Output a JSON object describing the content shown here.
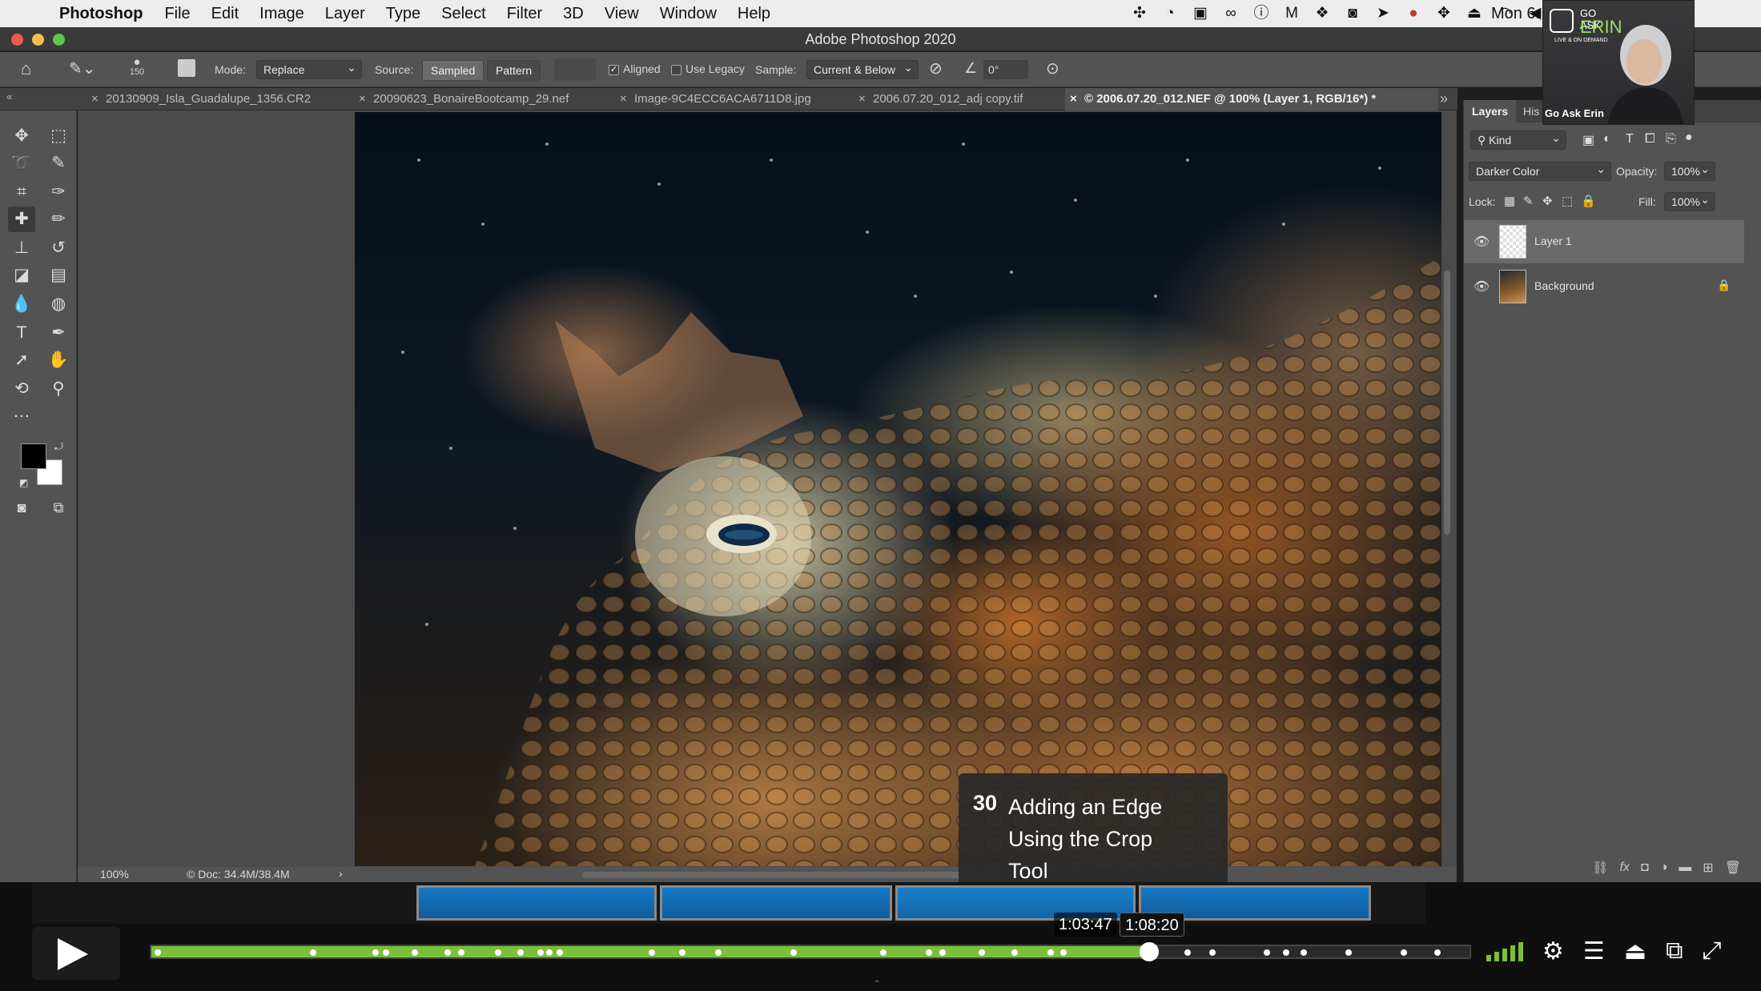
{
  "menubar": {
    "app_name": "Photoshop",
    "items": [
      "File",
      "Edit",
      "Image",
      "Layer",
      "Type",
      "Select",
      "Filter",
      "3D",
      "View",
      "Window",
      "Help"
    ],
    "clock": "Mon 6:"
  },
  "window": {
    "title": "Adobe Photoshop 2020"
  },
  "options": {
    "brush_size": "150",
    "mode_label": "Mode:",
    "mode_value": "Replace",
    "source_label": "Source:",
    "source_sampled": "Sampled",
    "source_pattern": "Pattern",
    "aligned_label": "Aligned",
    "aligned_checked": true,
    "use_legacy_label": "Use Legacy",
    "sample_label": "Sample:",
    "sample_value": "Current & Below",
    "angle_value": "0°"
  },
  "tabs": [
    {
      "label": "20130909_Isla_Guadalupe_1356.CR2",
      "active": false
    },
    {
      "label": "20090623_BonaireBootcamp_29.nef",
      "active": false
    },
    {
      "label": "Image-9C4ECC6ACA6711D8.jpg",
      "active": false
    },
    {
      "label": "2006.07.20_012_adj copy.tif",
      "active": false
    },
    {
      "label": "© 2006.07.20_012.NEF @ 100% (Layer 1, RGB/16*) *",
      "active": true
    }
  ],
  "status": {
    "zoom": "100%",
    "doc": "Doc: 34.4M/38.4M"
  },
  "layers_panel": {
    "tabs": [
      "Layers",
      "His"
    ],
    "kind_label": "Kind",
    "blend_mode": "Darker Color",
    "opacity_label": "Opacity:",
    "opacity_value": "100%",
    "lock_label": "Lock:",
    "fill_label": "Fill:",
    "fill_value": "100%",
    "layers": [
      {
        "name": "Layer 1",
        "selected": true,
        "locked": false
      },
      {
        "name": "Background",
        "selected": false,
        "locked": true
      }
    ]
  },
  "webcam": {
    "logo_top": "GO ASK",
    "logo_main": "ERIN",
    "logo_sub": "LIVE & ON DEMAND",
    "caption": "Go Ask Erin"
  },
  "chapter": {
    "number": "30",
    "title": "Adding an Edge Using the Crop Tool"
  },
  "player": {
    "current_time": "1:03:47",
    "hover_time": "1:08:20",
    "progress_fraction": 0.757,
    "buffered_fraction": 0.763,
    "accent_color": "#79c13a",
    "chapter_marker_fractions": [
      0.005,
      0.123,
      0.17,
      0.178,
      0.2,
      0.225,
      0.235,
      0.263,
      0.28,
      0.295,
      0.302,
      0.31,
      0.38,
      0.403,
      0.43,
      0.487,
      0.555,
      0.59,
      0.6,
      0.63,
      0.655,
      0.682,
      0.692,
      0.91,
      0.928,
      0.967,
      0.98,
      0.993
    ],
    "chapter_marker_fractions_right": [
      0.786,
      0.805,
      0.846,
      0.861,
      0.874,
      0.908,
      0.95,
      0.976
    ]
  },
  "colors": {
    "foreground": "#000000",
    "background": "#ffffff"
  }
}
